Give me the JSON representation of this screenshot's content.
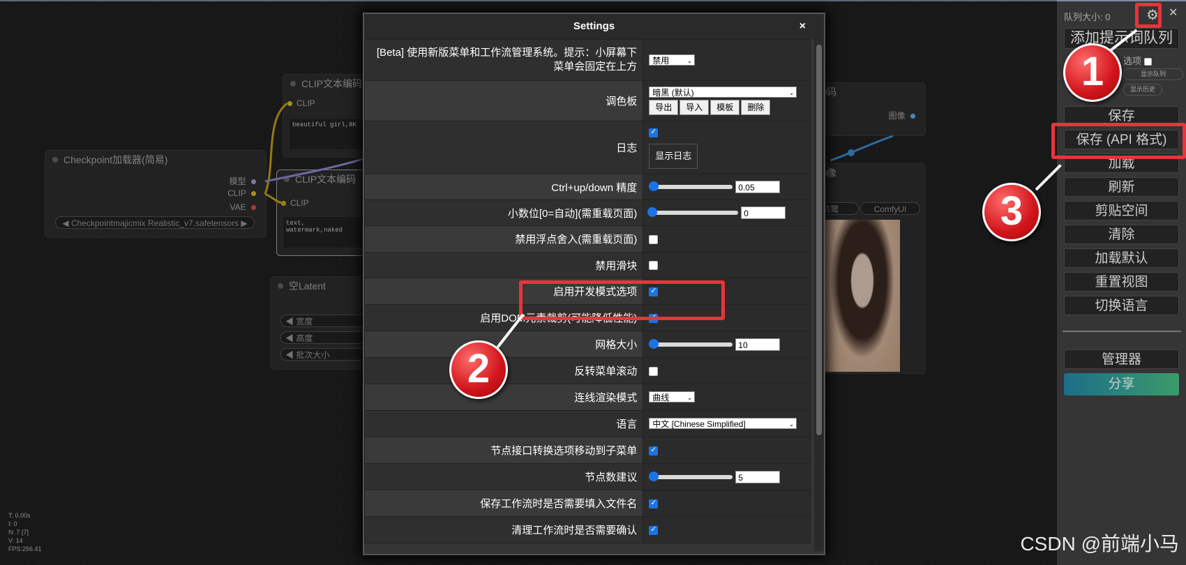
{
  "canvas": {
    "nodes": {
      "clip1": {
        "title": "CLIP文本编码",
        "slot_in": "CLIP",
        "text": "beautiful girl,8K"
      },
      "clip2": {
        "title": "CLIP文本编码",
        "slot_in": "CLIP",
        "text": "text, watermark,naked"
      },
      "checkpoint": {
        "title": "Checkpoint加载器(简易)",
        "out_model": "模型",
        "out_clip": "CLIP",
        "out_vae": "VAE",
        "ckpt_value": "Checkpointmajicmix Realistic_v7.safetensors"
      },
      "latent": {
        "title": "空Latent",
        "width": "宽度",
        "height": "高度",
        "batch": "批次大小"
      },
      "decode": {
        "title": "码",
        "out": "图像"
      },
      "preview": {
        "title": "像",
        "tab1": "鹤鹭",
        "tab2": "ComfyUI"
      }
    },
    "stats": [
      "T: 0.00s",
      "I: 0",
      "N: 7 [7]",
      "V: 14",
      "FPS:256.41"
    ]
  },
  "modal": {
    "title": "Settings",
    "close": "×",
    "rows": [
      {
        "label": "[Beta] 使用新版菜单和工作流管理系统。提示：小屏幕下菜单会固定在上方",
        "select": "禁用"
      },
      {
        "label": "调色板",
        "select": "暗黑 (默认)",
        "buttons": [
          "导出",
          "导入",
          "模板",
          "删除"
        ]
      },
      {
        "label": "日志",
        "checked": "true",
        "button": "显示日志"
      },
      {
        "label": "Ctrl+up/down 精度",
        "slider": 0.05,
        "value": "0.05"
      },
      {
        "label": "小数位[0=自动](需重载页面)",
        "slider": 0,
        "value": "0"
      },
      {
        "label": "禁用浮点舍入(需重载页面)",
        "checked": "false"
      },
      {
        "label": "禁用滑块",
        "checked": "false"
      },
      {
        "label": "启用开发模式选项",
        "checked": "true"
      },
      {
        "label": "启用DOM元素裁剪(可能降低性能)",
        "checked": "true"
      },
      {
        "label": "网格大小",
        "slider": 10,
        "value": "10"
      },
      {
        "label": "反转菜单滚动",
        "checked": "false"
      },
      {
        "label": "连线渲染模式",
        "select": "曲线"
      },
      {
        "label": "语言",
        "select": "中文 [Chinese Simplified]"
      },
      {
        "label": "节点接口转换选项移动到子菜单",
        "checked": "true"
      },
      {
        "label": "节点数建议",
        "slider": 5,
        "value": "5"
      },
      {
        "label": "保存工作流时是否需要填入文件名",
        "checked": "true"
      },
      {
        "label": "清理工作流时是否需要确认",
        "checked": "true"
      }
    ]
  },
  "menu": {
    "queue_size": "队列大小: 0",
    "add_queue": "添加提示词队列",
    "extra_options": "选项",
    "show_queue": "显示队列",
    "show_history": "显示历史",
    "buttons": [
      "保存",
      "保存 (API 格式)",
      "加载",
      "刷新",
      "剪贴空间",
      "清除",
      "加载默认",
      "重置视图",
      "切换语言"
    ],
    "manager": "管理器",
    "share": "分享"
  },
  "annotations": {
    "badge1": "1",
    "badge2": "2",
    "badge3": "3",
    "highlight_color": "#e8343b"
  },
  "watermark": "CSDN @前端小马"
}
